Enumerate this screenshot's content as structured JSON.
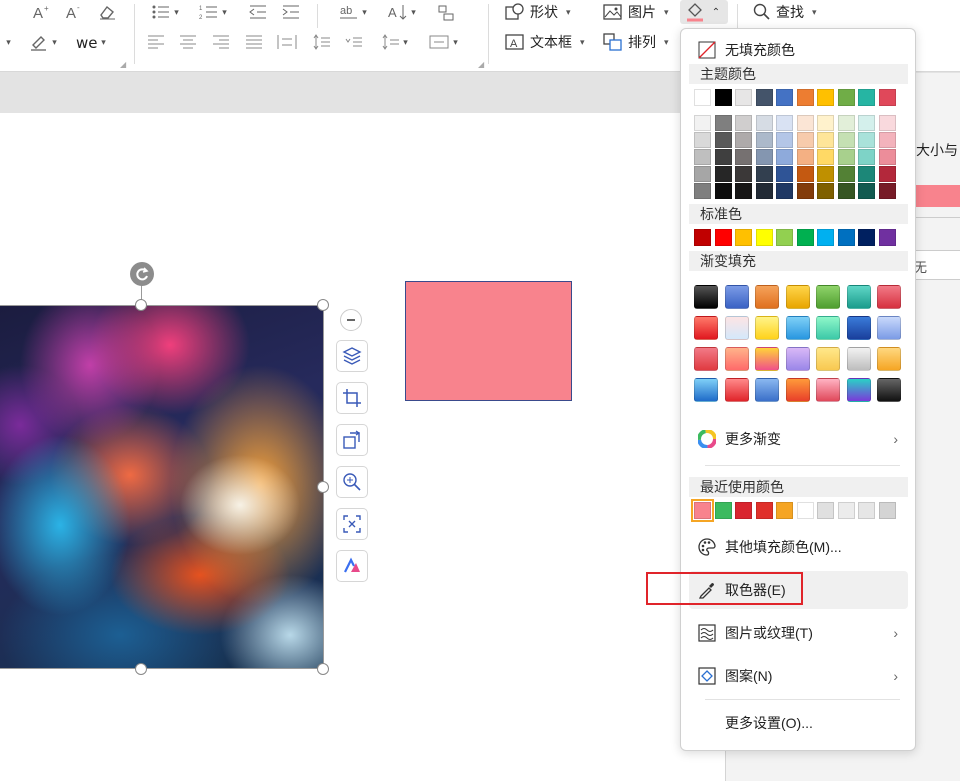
{
  "ribbon": {
    "shape_label": "形状",
    "picture_label": "图片",
    "textbox_label": "文本框",
    "arrange_label": "排列",
    "find_label": "查找"
  },
  "right_pane": {
    "size_text": "大小与",
    "field_text": "无"
  },
  "dropdown": {
    "no_fill": "无填充颜色",
    "theme_header": "主题颜色",
    "standard_header": "标准色",
    "gradient_header": "渐变填充",
    "more_gradient": "更多渐变",
    "recent_header": "最近使用颜色",
    "other_fill": "其他填充颜色(M)...",
    "eyedropper": "取色器(E)",
    "picture_texture": "图片或纹理(T)",
    "pattern": "图案(N)",
    "more_settings": "更多设置(O)...",
    "theme_top": [
      "#ffffff",
      "#000000",
      "#e7e6e6",
      "#44546a",
      "#4472c4",
      "#ed7d31",
      "#ffc000",
      "#70ad47",
      "#26b5a3",
      "#e0485a"
    ],
    "theme_shades": [
      [
        "#f2f2f2",
        "#7f7f7f",
        "#d0cece",
        "#d6dce4",
        "#d9e2f3",
        "#fbe5d5",
        "#fff2cc",
        "#e2efd9",
        "#d4f0ec",
        "#f9d9dd"
      ],
      [
        "#d9d9d9",
        "#595959",
        "#aeaaaa",
        "#acb9ca",
        "#b4c6e7",
        "#f7cbac",
        "#fee599",
        "#c5e0b3",
        "#a9e2da",
        "#f3b3bc"
      ],
      [
        "#bfbfbf",
        "#3f3f3f",
        "#767171",
        "#8496b0",
        "#8eaadb",
        "#f4b083",
        "#ffd965",
        "#a8d08d",
        "#7ed3c7",
        "#ec8d9a"
      ],
      [
        "#a6a6a6",
        "#262626",
        "#3b3838",
        "#323f4f",
        "#2f5496",
        "#c45911",
        "#bf9000",
        "#538135",
        "#1c8778",
        "#b3283b"
      ],
      [
        "#7f7f7f",
        "#0d0d0d",
        "#171616",
        "#222a35",
        "#1f3864",
        "#833c0b",
        "#7f6000",
        "#375623",
        "#125a50",
        "#771b27"
      ]
    ],
    "standard": [
      "#c00000",
      "#ff0000",
      "#ffc000",
      "#ffff00",
      "#92d050",
      "#00b050",
      "#00b0f0",
      "#0070c0",
      "#002060",
      "#7030a0"
    ],
    "gradients": [
      [
        "linear-gradient(#555,#000)",
        "linear-gradient(#7b9be6,#3a62c4)",
        "linear-gradient(#f5a25a,#e0701f)",
        "linear-gradient(#ffd54a,#e8a500)",
        "linear-gradient(#8fd36a,#4f9e2f)",
        "linear-gradient(#5fd6c6,#1a9c8c)",
        "linear-gradient(#f27a87,#d6303f)"
      ],
      [
        "linear-gradient(#ff7a6a,#e0181f)",
        "linear-gradient(#fde4e4,#d4e8fb)",
        "linear-gradient(#fff48a,#ffd21a)",
        "linear-gradient(#7fd0f7,#2896e0)",
        "linear-gradient(#8ff7c9,#3cc9a8)",
        "linear-gradient(#3a7bd9,#1a3f9c)",
        "linear-gradient(#c9d9fb,#7b9be6)"
      ],
      [
        "linear-gradient(#f27a87,#e03a40)",
        "linear-gradient(#ffb38a,#ff6a6a)",
        "linear-gradient(#ffd33a,#f0508a)",
        "linear-gradient(#d9b8f7,#9a86e8)",
        "linear-gradient(#ffe88a,#f8c850)",
        "linear-gradient(#f2f2f2,#bdbdbd)",
        "linear-gradient(#ffd880,#f5a524)"
      ],
      [
        "linear-gradient(#7fd0f7,#1f6bc9)",
        "linear-gradient(#ff8a8a,#e0242a)",
        "linear-gradient(#8ab8f0,#3a6fc9)",
        "linear-gradient(#ff9a3a,#e8402a)",
        "linear-gradient(#ffb3c3,#e0485a)",
        "linear-gradient(#2ad1c6,#7a3ad9)",
        "linear-gradient(#666,#111)"
      ]
    ],
    "recent": [
      "#f8838d",
      "#3cba5f",
      "#d9252f",
      "#e0302a",
      "#f5a524",
      "#ffffff",
      "#e0e0e0",
      "#ececec",
      "#e6e6e6",
      "#d4d4d4"
    ]
  }
}
